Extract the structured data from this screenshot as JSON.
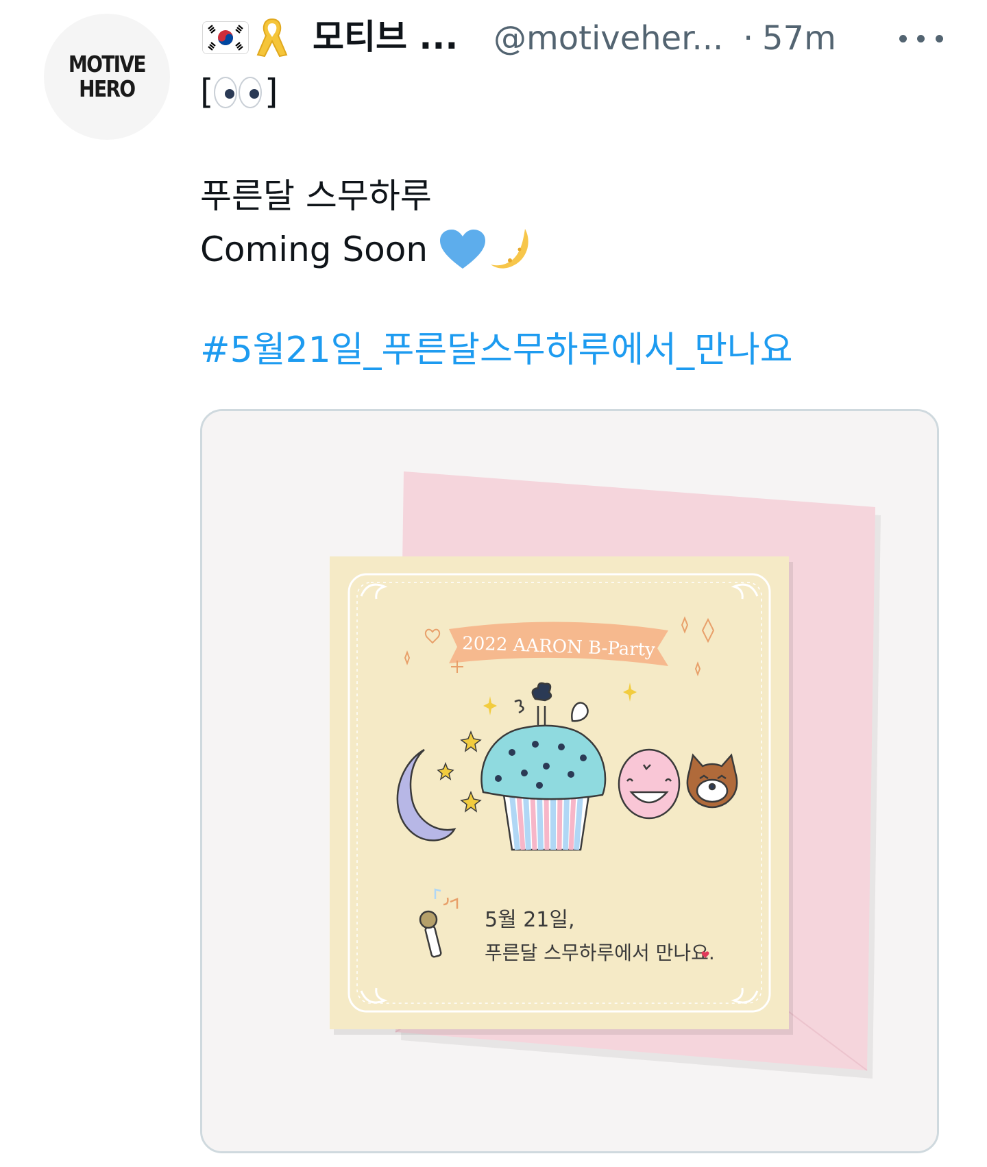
{
  "tweet": {
    "author": {
      "avatar_line1": "MOTIVE",
      "avatar_line2": "HERO",
      "display_name": "모티브 ...",
      "handle": "@motiveher...",
      "badges": [
        "korea-flag-icon",
        "yellow-ribbon-icon"
      ]
    },
    "separator": "·",
    "time": "57m",
    "more_icon": "more-options-icon",
    "body": {
      "eyes_open": "[",
      "eyes_close": "]",
      "eyes_icon": "eyes-emoji",
      "line2": "푸른달 스무하루",
      "line3": "Coming Soon",
      "emojis": [
        "blue-heart-emoji",
        "crescent-moon-emoji"
      ],
      "hashtag": "#5월21일_푸른달스무하루에서_만나요"
    },
    "media": {
      "banner": "2022 AARON B-Party",
      "hand_line1": "5월 21일,",
      "hand_line2": "푸른달 스무하루에서 만나요.",
      "card_color": "#f5eac6",
      "envelope_color": "#f5d5dc"
    }
  },
  "colors": {
    "link": "#1d9bf0",
    "secondary": "#536471",
    "text": "#0f1419",
    "border": "#cfd9de"
  }
}
